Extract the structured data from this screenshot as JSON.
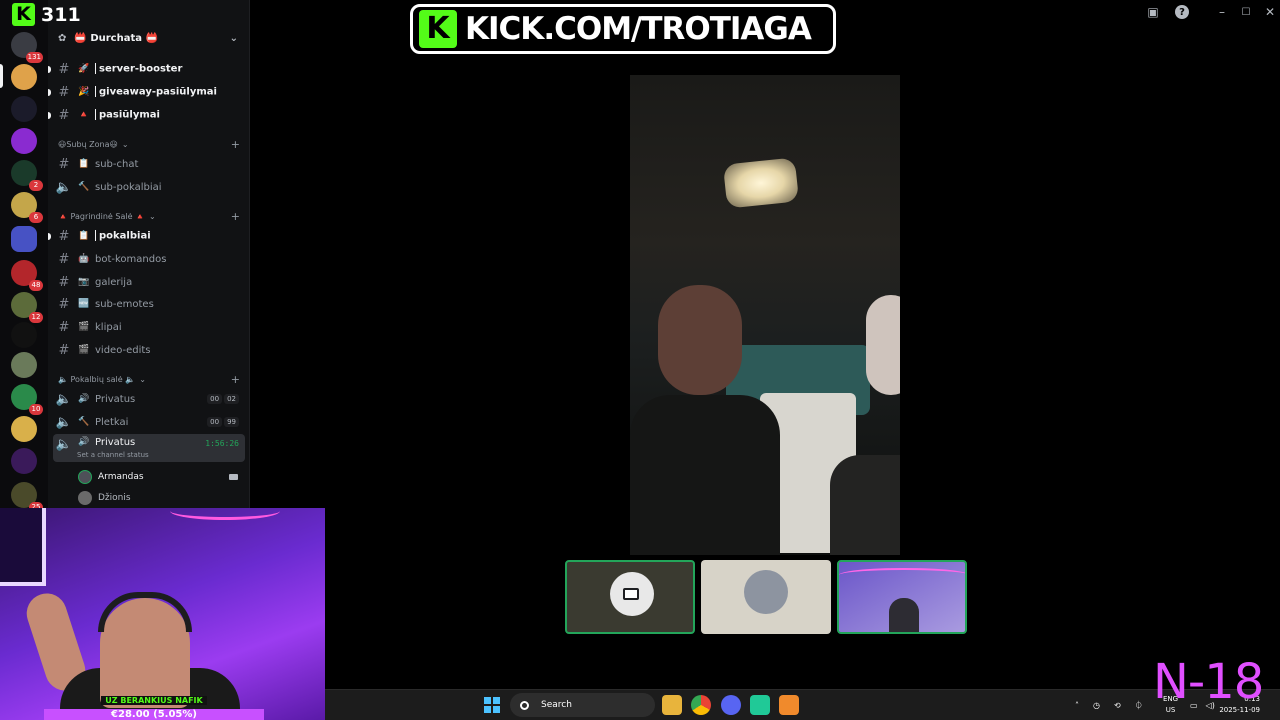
{
  "kick": {
    "count": "311",
    "logo_letter": "K",
    "banner_url": "KICK.COM/TROTIAGA"
  },
  "window_title": "… Durchata",
  "server": {
    "name": "📛 Durchata 📛"
  },
  "rail_badges": [
    "131",
    "2",
    "6",
    "48",
    "12",
    "10",
    "25"
  ],
  "channels_top": [
    {
      "emoji": "🚀",
      "name": "server-booster"
    },
    {
      "emoji": "🎉",
      "name": "giveaway-pasiūlymai"
    },
    {
      "emoji": "🔺",
      "name": "pasiūlymai"
    }
  ],
  "category_subu": {
    "label": "😃Subų Zona😃"
  },
  "subu_channels": [
    {
      "emoji": "📋",
      "name": "sub-chat",
      "type": "text"
    },
    {
      "emoji": "🔨",
      "name": "sub-pokalbiai",
      "type": "voice"
    }
  ],
  "category_main": {
    "label": "🔺 Pagrindinė Salė 🔺"
  },
  "main_channels": [
    {
      "emoji": "📋",
      "name": "pokalbiai"
    },
    {
      "emoji": "🤖",
      "name": "bot-komandos"
    },
    {
      "emoji": "📷",
      "name": "galerija"
    },
    {
      "emoji": "🆕",
      "name": "sub-emotes"
    },
    {
      "emoji": "🎬",
      "name": "klipai"
    },
    {
      "emoji": "🎬",
      "name": "video-edits"
    }
  ],
  "category_voice": {
    "label": "🔈 Pokalbių salė 🔈"
  },
  "voice_channels": [
    {
      "name": "Privatus",
      "count_a": "00",
      "count_b": "02"
    },
    {
      "name": "Pletkai",
      "count_a": "00",
      "count_b": "99"
    }
  ],
  "active_voice": {
    "name": "Privatus",
    "timer": "1:56:26",
    "status": "Set a channel status"
  },
  "voice_users": [
    "Armandas",
    "Džionis"
  ],
  "donation": {
    "line1": "UZ BERANKIUS NAFIK",
    "line2": "€28.00 (5.05%)"
  },
  "taskbar": {
    "search_placeholder": "Search",
    "lang_top": "ENG",
    "lang_bottom": "US",
    "time": "0:13",
    "date": "2025-11-09"
  },
  "overlay_rating": "N-18",
  "colors": {
    "kick_green": "#53fc18",
    "discord_green": "#23a55a",
    "purple": "#9b3cf0"
  },
  "icons": [
    "hash-icon",
    "speaker-icon",
    "camera-icon",
    "help-icon",
    "inbox-icon",
    "search-icon",
    "chevron-down-icon",
    "plus-icon",
    "windows-start-icon"
  ]
}
